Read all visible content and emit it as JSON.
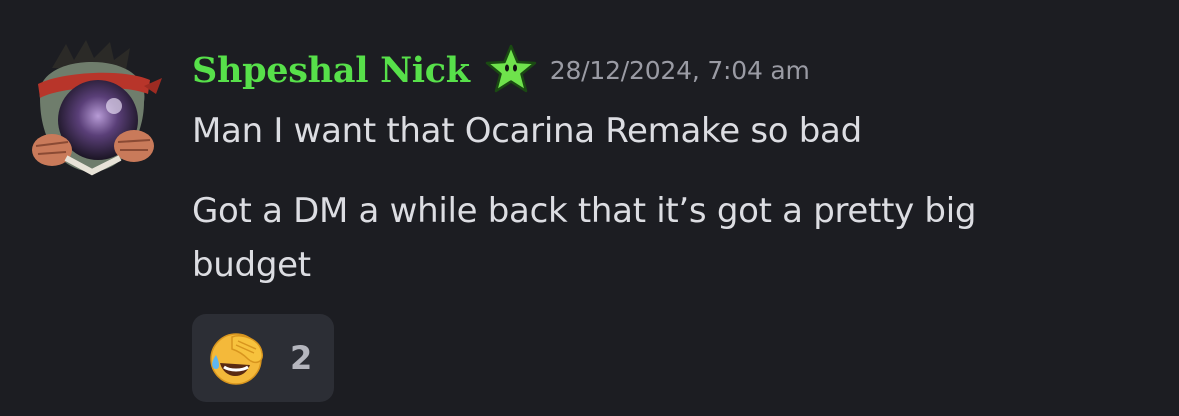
{
  "message": {
    "author": "Shpeshal Nick",
    "timestamp": "28/12/2024, 7:04 am",
    "lines": [
      "Man I want that Ocarina Remake so bad",
      "Got a DM a while back that it’s got a pretty big budget"
    ],
    "badge_icon": "green-star-icon",
    "avatar_icon": "fighter-avatar-icon"
  },
  "reaction": {
    "emoji": "face-palm-laughing-emoji",
    "count": "2"
  },
  "colors": {
    "background": "#1c1d22",
    "username": "#57e04a",
    "text": "#dcdde2",
    "timestamp": "#9a9ba4",
    "reaction_bg": "#2c2e35"
  }
}
